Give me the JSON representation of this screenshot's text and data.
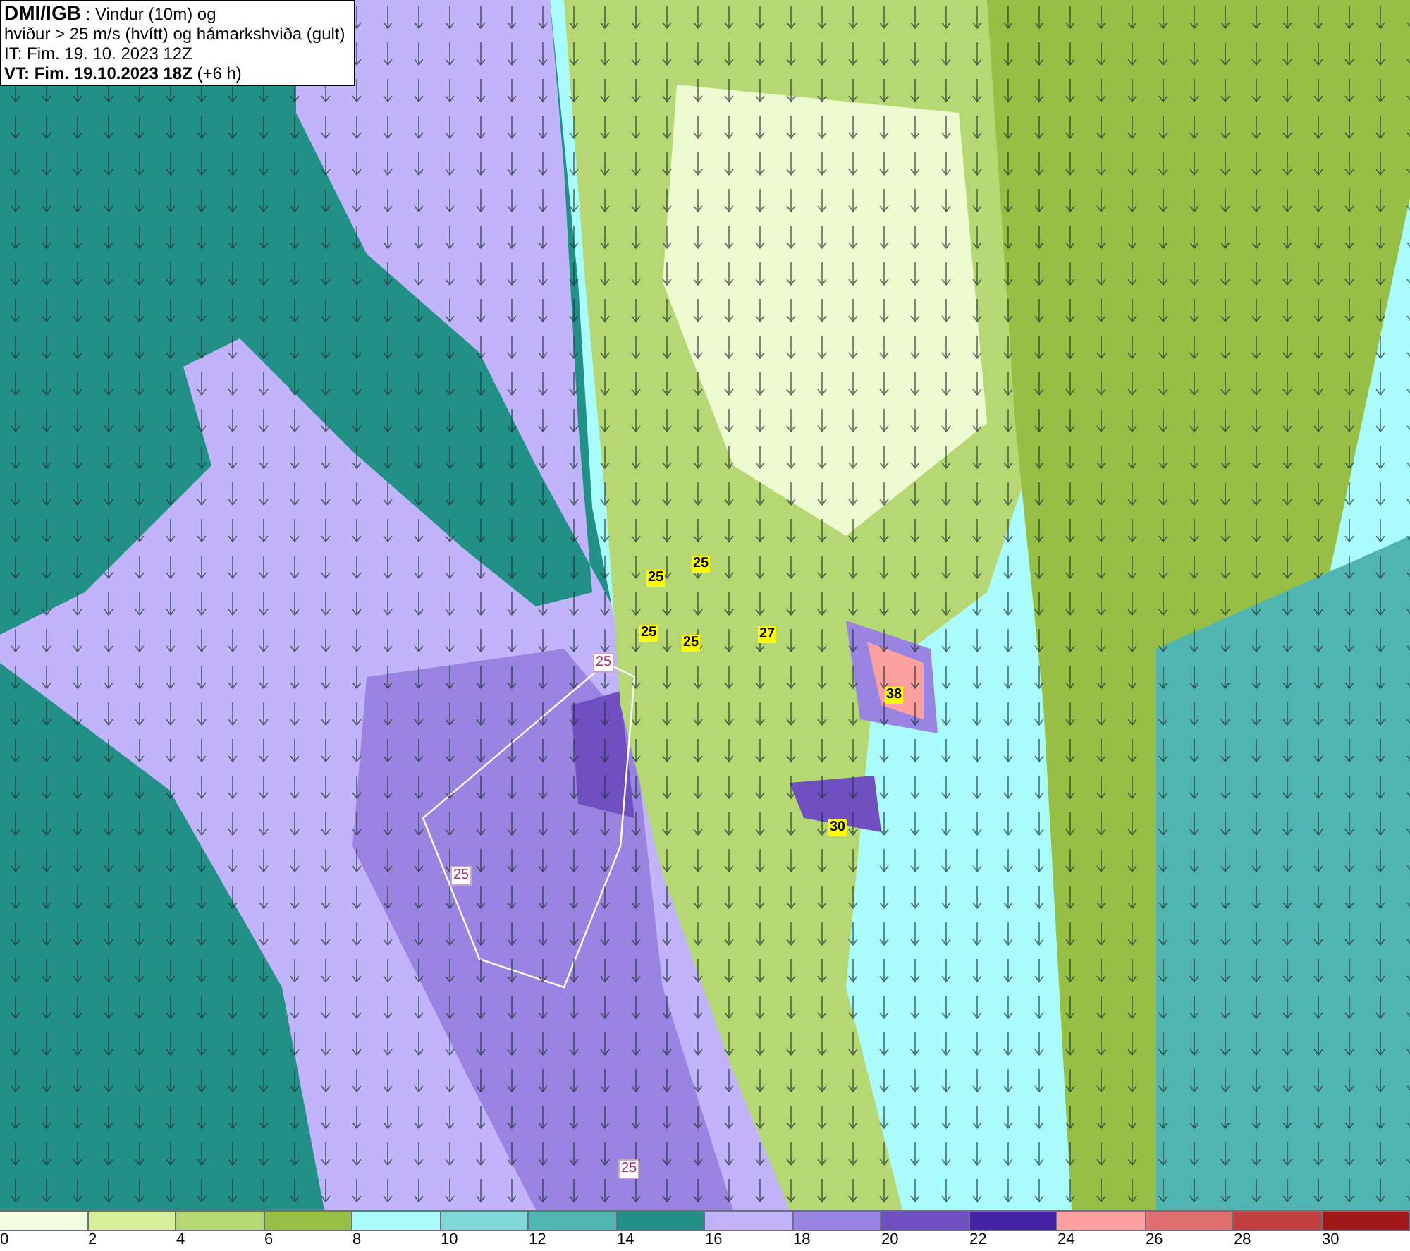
{
  "header": {
    "title": "DMI/IGB",
    "title_rest": ": Vindur (10m) og",
    "line2": "hviður > 25 m/s (hvítt) og hámarkshviða (gult)",
    "it_line": "IT: Fim. 19. 10. 2023 12Z",
    "vt": "VT: Fim. 19.10.2023 18Z",
    "vt_rest": "(+6 h)"
  },
  "gust_labels": [
    {
      "kind": "max",
      "text": "25"
    },
    {
      "kind": "max",
      "text": "25"
    },
    {
      "kind": "max",
      "text": "25"
    },
    {
      "kind": "max",
      "text": "25"
    },
    {
      "kind": "max",
      "text": "27"
    },
    {
      "kind": "max",
      "text": "38"
    },
    {
      "kind": "max",
      "text": "30"
    },
    {
      "kind": "contour",
      "text": "25"
    },
    {
      "kind": "contour",
      "text": "25"
    },
    {
      "kind": "contour",
      "text": "25"
    }
  ],
  "colorbar": [
    {
      "color": "#f4fde0",
      "label": "0"
    },
    {
      "color": "#d6f09a",
      "label": "2"
    },
    {
      "color": "#b6d874",
      "label": "4"
    },
    {
      "color": "#96bf45",
      "label": "6"
    },
    {
      "color": "#aafcfc",
      "label": "8"
    },
    {
      "color": "#80d8d8",
      "label": "10"
    },
    {
      "color": "#50b4b0",
      "label": "12"
    },
    {
      "color": "#239088",
      "label": "14"
    },
    {
      "color": "#c2b4fa",
      "label": "16"
    },
    {
      "color": "#9a84e2",
      "label": "18"
    },
    {
      "color": "#7050c0",
      "label": "20"
    },
    {
      "color": "#4424a4",
      "label": "22"
    },
    {
      "color": "#fca0a0",
      "label": "24"
    },
    {
      "color": "#e07070",
      "label": "26"
    },
    {
      "color": "#c04040",
      "label": "28"
    },
    {
      "color": "#a01818",
      "label": "30"
    }
  ]
}
